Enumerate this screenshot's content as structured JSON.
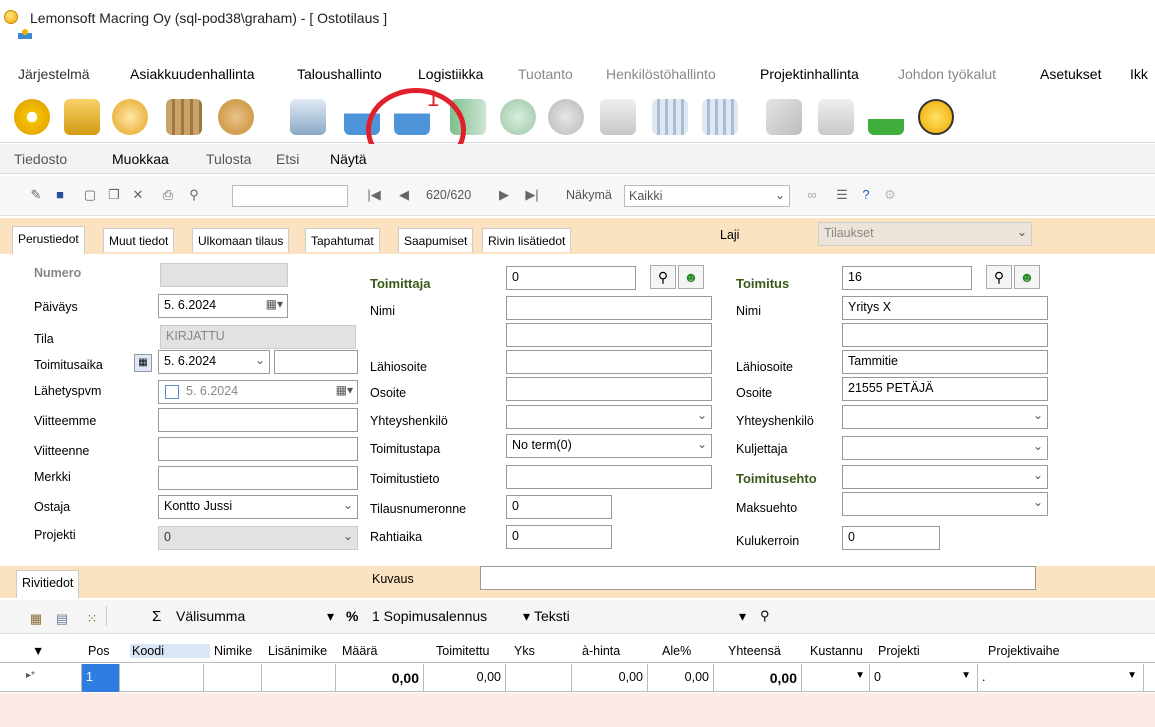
{
  "window": {
    "title": "Lemonsoft Macring Oy (sql-pod38\\graham) - [ Ostotilaus ]"
  },
  "menubar": [
    "Järjestelmä",
    "Asiakkuudenhallinta",
    "Taloushallinto",
    "Logistiikka",
    "Tuotanto",
    "Henkilöstöhallinto",
    "Projektinhallinta",
    "Johdon työkalut",
    "Asetukset",
    "Ikk"
  ],
  "annotation": {
    "marker": "1"
  },
  "submenu": [
    "Tiedosto",
    "Muokkaa",
    "Tulosta",
    "Etsi",
    "Näytä"
  ],
  "nav": {
    "record": "620/620",
    "view_label": "Näkymä",
    "view_value": "Kaikki"
  },
  "tabs": [
    "Perustiedot",
    "Muut tiedot",
    "Ulkomaan tilaus",
    "Tapahtumat",
    "Saapumiset",
    "Rivin lisätiedot"
  ],
  "laji": {
    "label": "Laji",
    "value": "Tilaukset"
  },
  "form": {
    "numero": "Numero",
    "paivays": "Päiväys",
    "paivays_val": "5. 6.2024",
    "tila": "Tila",
    "tila_val": "KIRJATTU",
    "toimitusaika": "Toimitusaika",
    "toimitusaika_val": "5. 6.2024",
    "lahetyspvm": "Lähetyspvm",
    "lahetyspvm_val": "5. 6.2024",
    "viitteemme": "Viitteemme",
    "viitteenne": "Viitteenne",
    "merkki": "Merkki",
    "ostaja": "Ostaja",
    "ostaja_val": "Kontto Jussi",
    "projekti": "Projekti",
    "projekti_val": "0",
    "toimittaja": "Toimittaja",
    "toimittaja_val": "0",
    "nimi": "Nimi",
    "lahiosoite": "Lähiosoite",
    "osoite": "Osoite",
    "yhteyshenkilo": "Yhteyshenkilö",
    "toimitustapa": "Toimitustapa",
    "toimitustapa_val": "No term(0)",
    "toimitustieto": "Toimitustieto",
    "tilausnumeronne": "Tilausnumeronne",
    "tilausnumeronne_val": "0",
    "rahtiaika": "Rahtiaika",
    "rahtiaika_val": "0",
    "toimitus": "Toimitus",
    "toimitus_val": "16",
    "t_nimi_val": "Yritys X",
    "t_lahiosoite_val": "Tammitie",
    "t_osoite_val": "21555  PETÄJÄ",
    "kuljettaja": "Kuljettaja",
    "toimitusehto": "Toimitusehto",
    "maksuehto": "Maksuehto",
    "kulukerroin": "Kulukerroin",
    "kulukerroin_val": "0",
    "kuvaus": "Kuvaus"
  },
  "rivitiedot": "Rivitiedot",
  "gridtool": {
    "sum": "Välisumma",
    "pct": "%",
    "discount": "1 Sopimusalennus",
    "text": "Teksti"
  },
  "grid": {
    "headers": [
      "Pos",
      "Koodi",
      "Nimike",
      "Lisänimike",
      "Määrä",
      "Toimitettu",
      "Yks",
      "à-hinta",
      "Ale%",
      "Yhteensä",
      "Kustannu",
      "Projekti",
      "Projektivaihe"
    ],
    "row": {
      "pos": "1",
      "maara": "0,00",
      "toimitettu": "0,00",
      "ahinta": "0,00",
      "ale": "0,00",
      "yhteensa": "0,00",
      "projekti": "0",
      "vaihe": "."
    }
  }
}
